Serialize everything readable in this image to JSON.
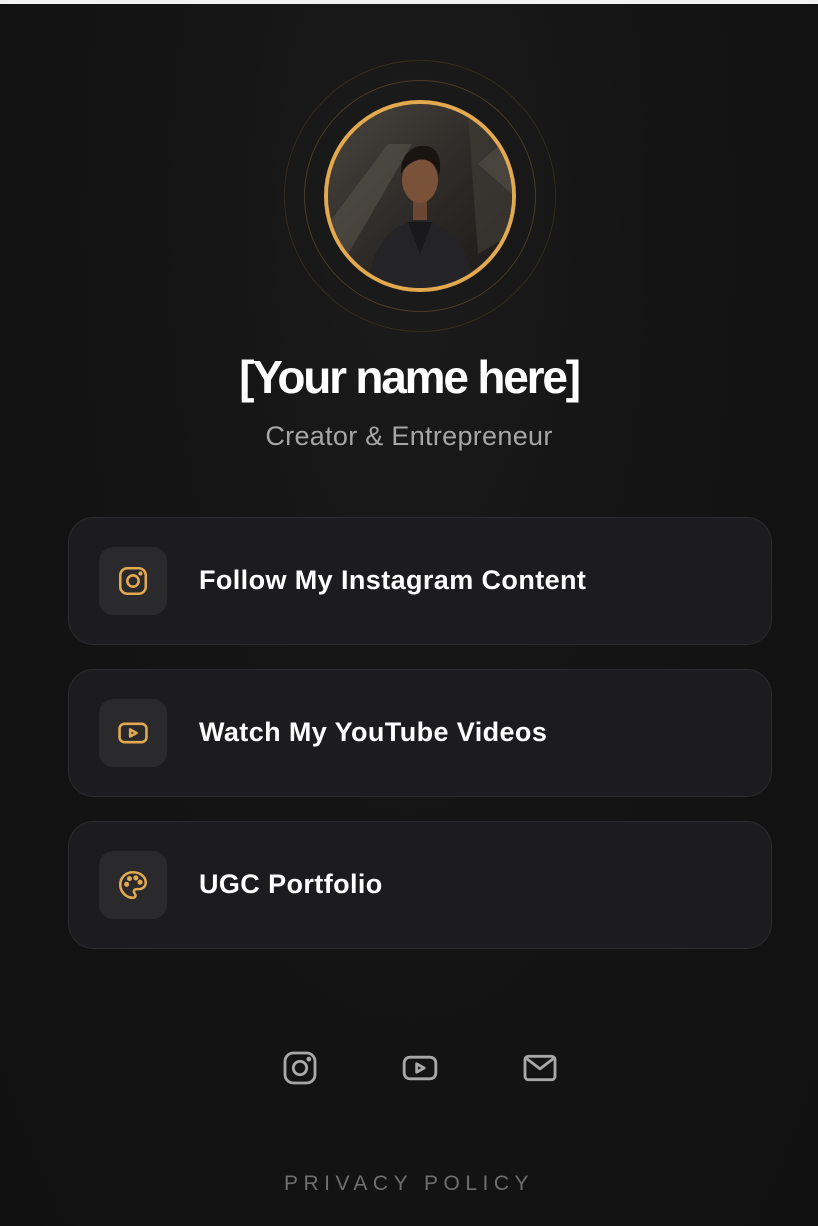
{
  "colors": {
    "accent": "#e3a94f",
    "background": "#121212",
    "card": "#1c1c1e",
    "icon_box": "#2a2a2c",
    "muted": "#a6a6a6"
  },
  "profile": {
    "avatar_icon": "profile-photo",
    "name": "[Your name here]",
    "tagline": "Creator & Entrepreneur"
  },
  "links": [
    {
      "icon": "instagram-icon",
      "label": "Follow My Instagram Content"
    },
    {
      "icon": "youtube-icon",
      "label": "Watch My YouTube Videos"
    },
    {
      "icon": "palette-icon",
      "label": "UGC Portfolio"
    }
  ],
  "social": [
    {
      "icon": "instagram-icon"
    },
    {
      "icon": "youtube-icon"
    },
    {
      "icon": "mail-icon"
    }
  ],
  "footer": {
    "privacy_label": "PRIVACY POLICY"
  }
}
